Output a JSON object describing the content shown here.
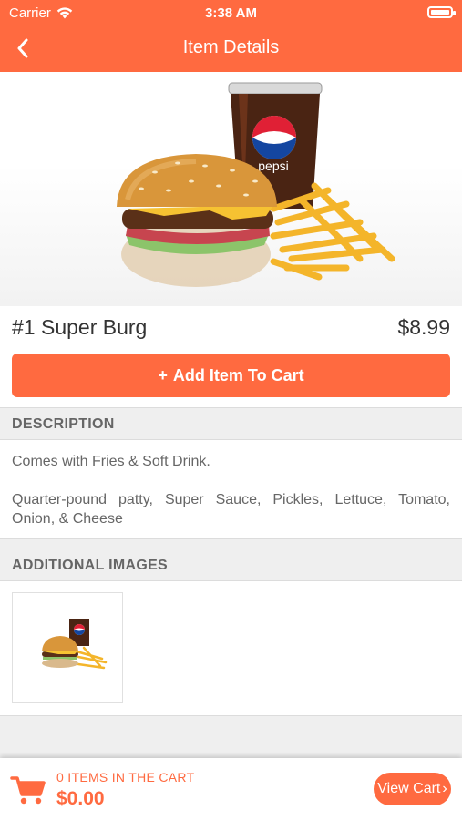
{
  "status_bar": {
    "carrier": "Carrier",
    "time": "3:38 AM"
  },
  "nav": {
    "title": "Item Details",
    "back_icon": "chevron-left-icon"
  },
  "item": {
    "name": "#1 Super Burg",
    "price": "$8.99",
    "image_brand_text": "pepsi"
  },
  "actions": {
    "add_to_cart_icon": "+",
    "add_to_cart_label": "Add Item To Cart"
  },
  "description": {
    "header": "DESCRIPTION",
    "line1": "Comes with Fries & Soft Drink.",
    "line2": "Quarter-pound patty, Super Sauce, Pickles, Lettuce, Tomato, Onion, & Cheese"
  },
  "additional_images": {
    "header": "ADDITIONAL IMAGES",
    "count": 1
  },
  "cart": {
    "items_label": "0 ITEMS IN THE CART",
    "total": "$0.00",
    "view_cart_label": "View Cart",
    "view_cart_icon": "›"
  },
  "colors": {
    "accent": "#FF6A40",
    "section_bg": "#efefef",
    "text": "#333333",
    "muted": "#666666"
  }
}
